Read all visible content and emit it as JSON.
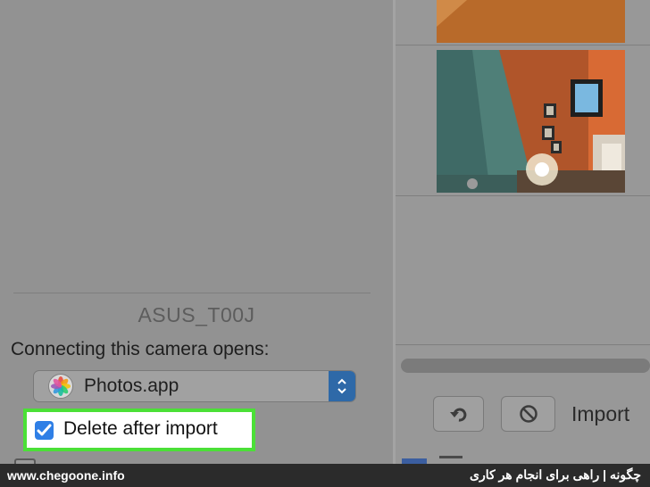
{
  "device": {
    "name": "ASUS_T00J"
  },
  "import_settings": {
    "connect_label": "Connecting this camera opens:",
    "app_select": {
      "value": "Photos.app",
      "icon": "photos-app-icon"
    },
    "delete_after_import": {
      "label": "Delete after import",
      "checked": true
    }
  },
  "toolbar": {
    "rotate_icon": "rotate-left-icon",
    "cancel_icon": "prohibited-icon",
    "import_label": "Import"
  },
  "footer": {
    "url": "www.chegoone.info",
    "brand": "چگونه | راهی برای انجام هر کاری"
  },
  "colors": {
    "highlight": "#4be037",
    "checkbox": "#2f7fe6",
    "select_arrows": "#2e69a8"
  }
}
